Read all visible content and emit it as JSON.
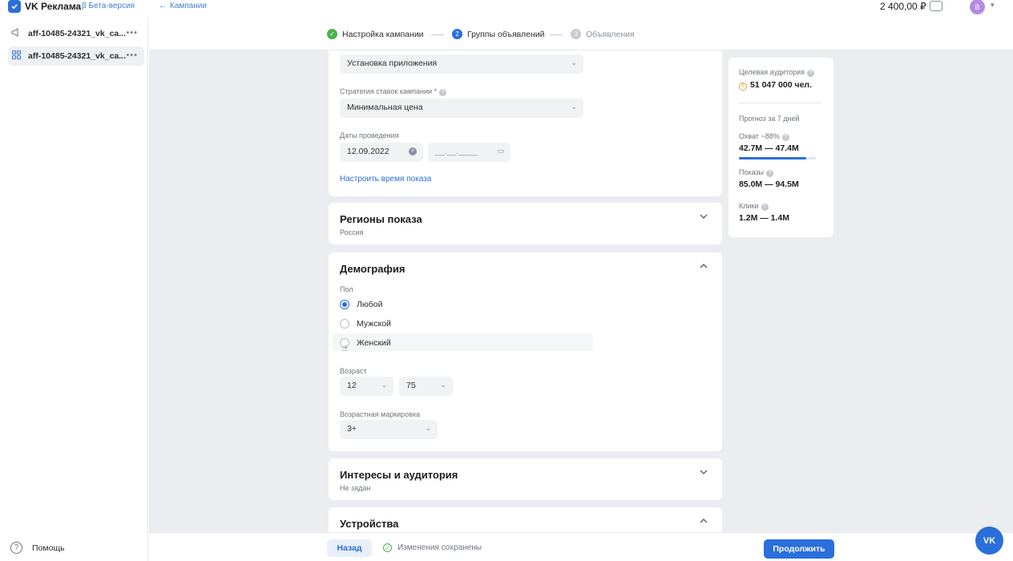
{
  "topbar": {
    "logo_text": "VK Реклама",
    "beta": "β Бета-версия",
    "back_arrow": "←",
    "back": "Кампании",
    "balance": "2 400,00 ₽",
    "avatar_letter": "В",
    "avatar_color": "#b58ae6"
  },
  "sidebar": {
    "items": [
      {
        "icon": "megaphone-icon",
        "label": "aff-10485-24321_vk_ca...",
        "more": "•••"
      },
      {
        "icon": "grid-icon",
        "label": "aff-10485-24321_vk_ca...",
        "more": "•••"
      }
    ],
    "help": "Помощь"
  },
  "stepper": {
    "steps": [
      {
        "num": "✓",
        "label": "Настройка кампании",
        "state": "done"
      },
      {
        "num": "2",
        "label": "Группы объявлений",
        "state": "active"
      },
      {
        "num": "3",
        "label": "Объявления",
        "state": "todo"
      }
    ]
  },
  "campaign": {
    "goal_value": "Установка приложения",
    "strategy_label": "Стратегия ставок кампании *",
    "strategy_value": "Минимальная цена",
    "dates_label": "Даты проведения",
    "date_start": "12.09.2022",
    "date_end_placeholder": "__.__.____",
    "time_link": "Настроить время показа"
  },
  "regions": {
    "title": "Регионы показа",
    "sub": "Россия"
  },
  "demography": {
    "title": "Демография",
    "gender_label": "Пол",
    "genders": [
      "Любой",
      "Мужской",
      "Женский"
    ],
    "selected_gender": "Любой",
    "age_label": "Возраст",
    "age_from": "12",
    "age_to": "75",
    "age_mark_label": "Возрастная маркировка",
    "age_mark": "3+"
  },
  "interests": {
    "title": "Интересы и аудитория",
    "sub": "Не задан"
  },
  "devices": {
    "title": "Устройства"
  },
  "stats": {
    "audience_label": "Целевая аудитория",
    "audience_value": "51 047 000 чел.",
    "forecast_label": "Прогноз за 7 дней",
    "reach_label": "Охват ~88%",
    "reach_value": "42.7M — 47.4M",
    "reach_fraction": 0.88,
    "impressions_label": "Показы",
    "impressions_value": "85.0M — 94.5M",
    "clicks_label": "Клики",
    "clicks_value": "1.2M — 1.4M"
  },
  "footer": {
    "back": "Назад",
    "saved": "Изменения сохранены",
    "next": "Продолжить",
    "fab": "VK"
  },
  "colors": {
    "accent": "#2a6fdb",
    "success": "#4bb34b",
    "background": "#ebedf0"
  }
}
